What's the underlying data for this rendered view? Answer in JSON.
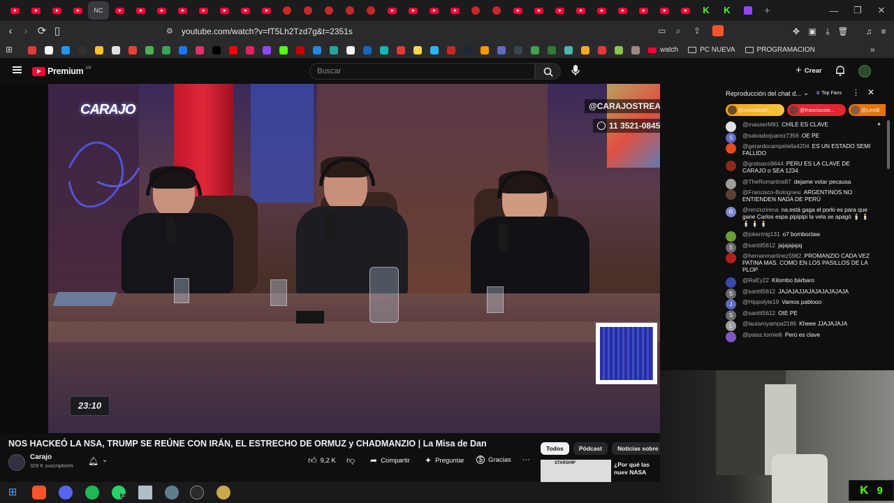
{
  "browser": {
    "tabs": [
      {
        "kind": "yt"
      },
      {
        "kind": "yt"
      },
      {
        "kind": "yt"
      },
      {
        "kind": "yt"
      },
      {
        "kind": "text",
        "label": "NC",
        "active": true
      },
      {
        "kind": "yt"
      },
      {
        "kind": "yt"
      },
      {
        "kind": "yt"
      },
      {
        "kind": "yt"
      },
      {
        "kind": "yt"
      },
      {
        "kind": "yt"
      },
      {
        "kind": "yt"
      },
      {
        "kind": "yt"
      },
      {
        "kind": "circ"
      },
      {
        "kind": "circ"
      },
      {
        "kind": "circ"
      },
      {
        "kind": "circ"
      },
      {
        "kind": "circ"
      },
      {
        "kind": "yt"
      },
      {
        "kind": "yt"
      },
      {
        "kind": "yt"
      },
      {
        "kind": "yt"
      },
      {
        "kind": "circ"
      },
      {
        "kind": "circ"
      },
      {
        "kind": "yt"
      },
      {
        "kind": "yt"
      },
      {
        "kind": "yt"
      },
      {
        "kind": "yt"
      },
      {
        "kind": "yt"
      },
      {
        "kind": "yt"
      },
      {
        "kind": "yt"
      },
      {
        "kind": "yt"
      },
      {
        "kind": "yt"
      },
      {
        "kind": "kick"
      },
      {
        "kind": "kick"
      },
      {
        "kind": "tw"
      }
    ],
    "new_tab": "+",
    "url": "youtube.com/watch?v=fT5Lh2Tzd7g&t=2351s",
    "bookmarks": {
      "colors": [
        "#e53935",
        "#f4f4f4",
        "#2196f3",
        "#333",
        "#fbc02d",
        "#e0e0e0",
        "#ea4335",
        "#4caf50",
        "#34a853",
        "#1877f2",
        "#e1306c",
        "#000",
        "#ff0000",
        "#e91e63",
        "#9146ff",
        "#53fc18",
        "#cc0000",
        "#1e88e5",
        "#26a69a",
        "#f5f5f5",
        "#1565c0",
        "#0fb9b1",
        "#e53935",
        "#ffd54f",
        "#29b6f6",
        "#c62828",
        "#1b2838",
        "#ff9800",
        "#5c6bc0",
        "#37474f",
        "#43a047",
        "#2e7d32",
        "#4db6ac",
        "#f9a825",
        "#e53935",
        "#8bc34a",
        "#a1887f"
      ],
      "watch": "watch",
      "folders": [
        "PC NUEVA",
        "PROGRAMACION"
      ]
    }
  },
  "youtube": {
    "logo": "Premium",
    "region": "AR",
    "search_placeholder": "Buscar",
    "create": "Crear",
    "video": {
      "brand": "CARAJO",
      "handle": "@CARAJOSTREAM",
      "phone": "11 3521-0845",
      "timestamp": "23:10"
    },
    "title": "NOS HACKEÓ LA NSA, TRUMP SE REÚNE CON IRÁN, EL ESTRECHO DE ORMUZ y CHADMANZIO | La Misa de Dan",
    "channel": "Carajo",
    "subscribers": "329 K suscriptores",
    "likes": "9,2 K",
    "share": "Compartir",
    "ask": "Preguntar",
    "thanks": "Gracias",
    "more": "···",
    "chips": [
      "Todos",
      "Pódcast",
      "Noticias sobre polí"
    ],
    "related": {
      "thumb_label": "STARSHIP",
      "title": "¿Por qué las nuev NASA para volver"
    }
  },
  "chat": {
    "header": "Reproducción del chat d...",
    "top_fans": "Top Fans",
    "fans": [
      "@maxideath...",
      "@franciscote...",
      "@LeviB"
    ],
    "messages": [
      {
        "author": "@mauserM91",
        "text": "CHILE ES CLAVE",
        "color": "#e0e0e0",
        "letter": ""
      },
      {
        "author": "@salvadorjuarez7356",
        "text": "OE PE",
        "color": "#5c6bc0",
        "letter": "S"
      },
      {
        "author": "@gerardocampetella4204",
        "text": "ES UN ESTADO SEMI FALLIDO",
        "color": "#e64a19",
        "letter": ""
      },
      {
        "author": "@gratsaco9644",
        "text": "PERU ES LA CLAVE DE CARAJO o SEA 1234",
        "color": "#8d2a1a",
        "letter": ""
      },
      {
        "author": "@TheRomartins87",
        "text": "dejame votar pecausa",
        "color": "#9e9e9e",
        "letter": ""
      },
      {
        "author": "@Francisco-Bolognesi",
        "text": "ARGENTINOS NO ENTIENDEN NADA DE PERÚ",
        "color": "#5d4037",
        "letter": ""
      },
      {
        "author": "@renzozirena",
        "text": "na,está gaga el porki es para que gane Carlos espa pipipipi la vela se apagó 🕯️ 🕯️ 🕯️ 🕯️ 🕯️",
        "color": "#7986cb",
        "letter": "R"
      },
      {
        "author": "@jokermig131",
        "text": "o7 bomboclaw",
        "color": "#689f38",
        "letter": ""
      },
      {
        "author": "@santtt5612",
        "text": "jajajajajaj",
        "color": "#6a6a6a",
        "letter": "S"
      },
      {
        "author": "@hernanmartinez5982",
        "text": "PROMANZIO CADA VEZ PATINA MAS. COMO EN LOS PASILLOS DE LA PLOP",
        "color": "#b71c1c",
        "letter": ""
      },
      {
        "author": "@RaEy22",
        "text": "Kilombo bárbaro",
        "color": "#3949ab",
        "letter": ""
      },
      {
        "author": "@santtt5612",
        "text": "JAJAJAJJAJAJAJAJAJAJA",
        "color": "#6a6a6a",
        "letter": "S"
      },
      {
        "author": "@Hippolyte19",
        "text": "Vamos pablooo",
        "color": "#5c6bc0",
        "letter": "J"
      },
      {
        "author": "@santtt5612",
        "text": "OIE PE",
        "color": "#6a6a6a",
        "letter": "S"
      },
      {
        "author": "@lautaroyampa2186",
        "text": "Kheee JJAJAJAJA",
        "color": "#9e9e9e",
        "letter": "L"
      },
      {
        "author": "@palas.tornielli",
        "text": "Perú es clave",
        "color": "#7e57c2",
        "letter": ""
      }
    ]
  },
  "overlay": {
    "kick_count": "9"
  },
  "taskbar": {
    "badge": "2"
  }
}
